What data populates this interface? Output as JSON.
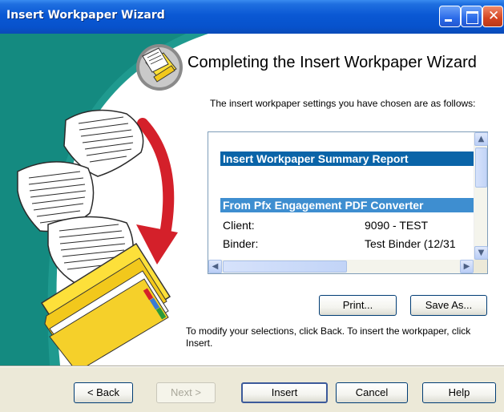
{
  "window": {
    "title": "Insert Workpaper Wizard",
    "title_bar_color": "#0a58d4",
    "controls": [
      "minimize-icon",
      "maximize-icon",
      "close-icon"
    ]
  },
  "heading": "Completing the Insert Workpaper Wizard",
  "intro": "The insert workpaper settings you have chosen are as follows:",
  "report": {
    "title": "Insert Workpaper Summary Report",
    "section": "From Pfx Engagement PDF Converter",
    "rows": [
      {
        "label": "Client:",
        "value": "9090 - TEST"
      },
      {
        "label": "Binder:",
        "value": "Test Binder (12/31"
      }
    ],
    "title_color": "#0a64a8",
    "section_color": "#3e8ed0"
  },
  "actions": {
    "print": "Print...",
    "save_as": "Save As..."
  },
  "modify_text": "To modify your selections, click Back.  To insert the workpaper, click Insert.",
  "footer": {
    "back": "< Back",
    "next": "Next >",
    "insert": "Insert",
    "cancel": "Cancel",
    "help": "Help"
  },
  "icons": {
    "wizard": "documents-folder-icon",
    "scroll_up": "arrow-up-icon",
    "scroll_down": "arrow-down-icon",
    "scroll_left": "arrow-left-icon",
    "scroll_right": "arrow-right-icon"
  }
}
